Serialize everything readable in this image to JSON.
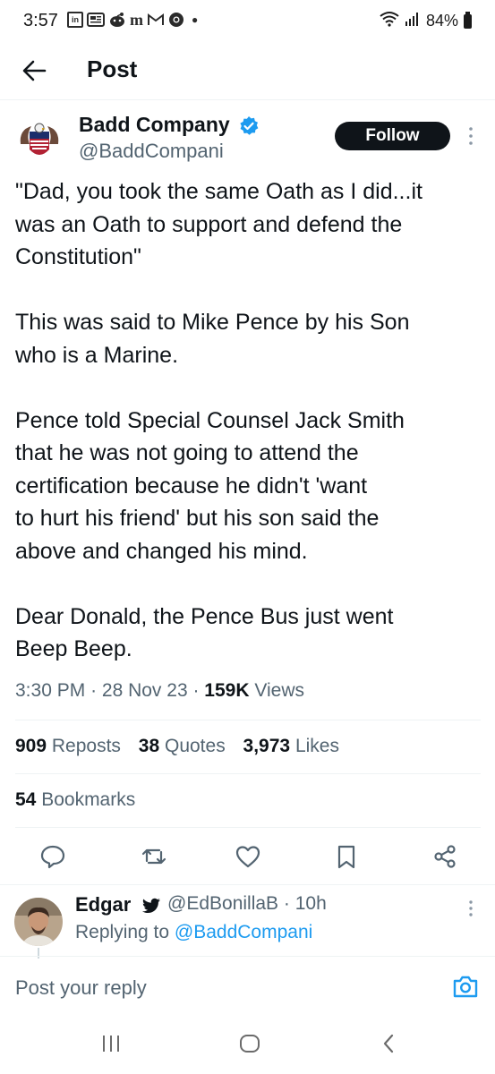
{
  "status_bar": {
    "time": "3:57",
    "notification_icons": [
      "linkedin-icon",
      "news-icon",
      "reddit-icon",
      "mail-icon",
      "gmail-icon",
      "chrome-icon"
    ],
    "battery": "84%"
  },
  "header": {
    "title": "Post"
  },
  "post": {
    "author_name": "Badd Company",
    "author_handle": "@BaddCompani",
    "follow_label": "Follow",
    "paragraphs": [
      [
        "\"Dad, you took the same Oath as I did...it",
        "was an Oath to support and defend the",
        "Constitution\""
      ],
      [
        "This was said to Mike Pence by his Son",
        "who is a Marine."
      ],
      [
        "Pence told Special Counsel Jack Smith",
        "that he was not going to attend the",
        "certification because he didn't 'want",
        "to hurt his friend' but his son said the",
        "above and changed his mind."
      ],
      [
        "Dear Donald, the Pence Bus just went",
        "Beep Beep."
      ]
    ],
    "time": "3:30 PM",
    "date": "28 Nov 23",
    "views_count": "159K",
    "views_label": "Views",
    "reposts_count": "909",
    "reposts_label": "Reposts",
    "quotes_count": "38",
    "quotes_label": "Quotes",
    "likes_count": "3,973",
    "likes_label": "Likes",
    "bookmarks_count": "54",
    "bookmarks_label": "Bookmarks"
  },
  "reply": {
    "name": "Edgar",
    "handle": "@EdBonillaB",
    "age": "10h",
    "replying_prefix": "Replying to",
    "replying_handle": "@BaddCompani"
  },
  "compose": {
    "placeholder": "Post your reply"
  },
  "colors": {
    "accent": "#1d9bf0",
    "text": "#0f1419",
    "secondary": "#536471",
    "divider": "#eff3f4"
  }
}
